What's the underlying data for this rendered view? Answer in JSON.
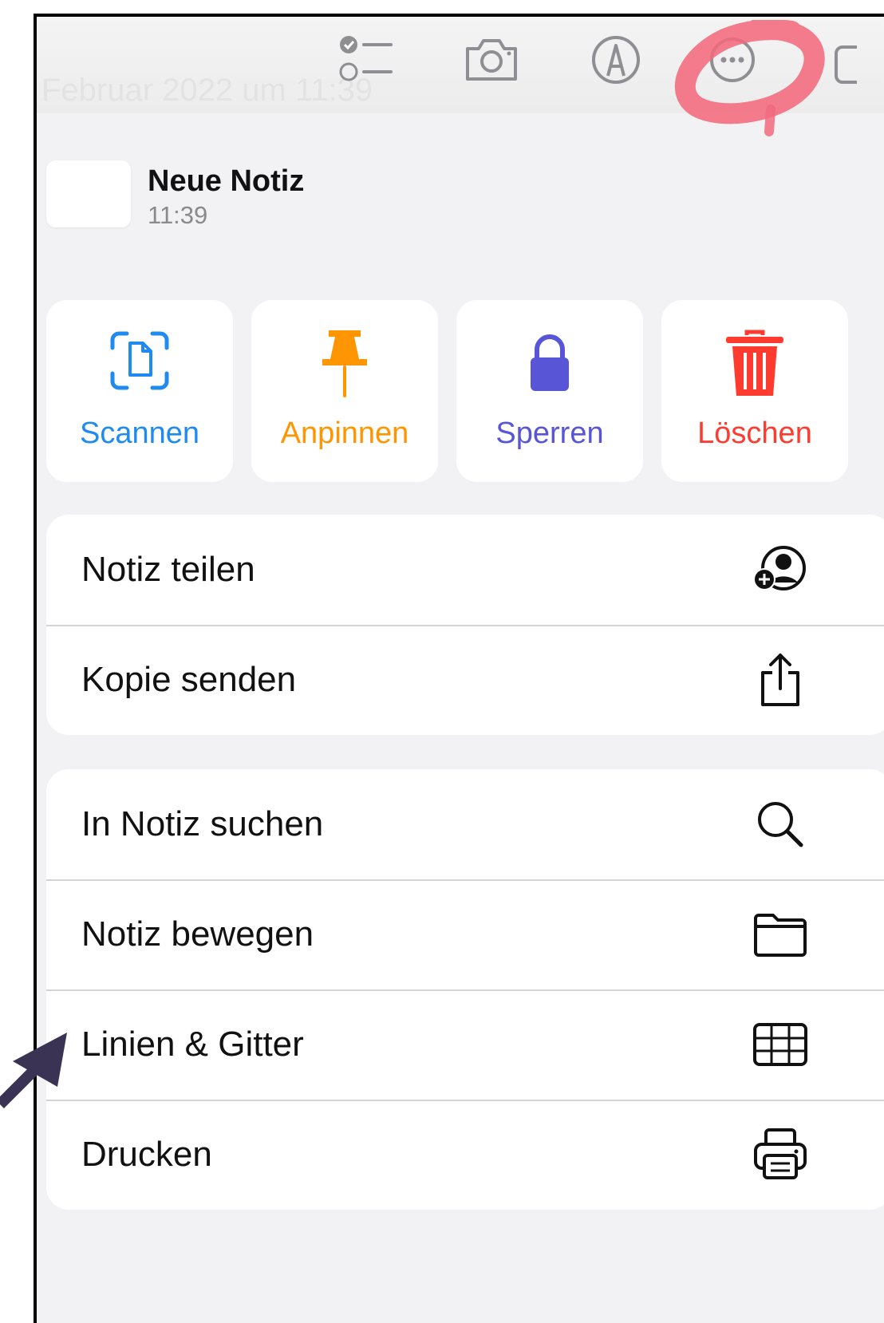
{
  "toolbar": {
    "faded_text": "Februar 2022 um 11:39",
    "icons": [
      "checklist-icon",
      "camera-icon",
      "markup-icon",
      "more-icon"
    ]
  },
  "note": {
    "title": "Neue Notiz",
    "time": "11:39"
  },
  "actions": [
    {
      "label": "Scannen",
      "icon": "scan-icon",
      "color": "#1f8bf0"
    },
    {
      "label": "Anpinnen",
      "icon": "pin-icon",
      "color": "#ff9500"
    },
    {
      "label": "Sperren",
      "icon": "lock-icon",
      "color": "#5856d6"
    },
    {
      "label": "Löschen",
      "icon": "trash-icon",
      "color": "#ff3b30"
    }
  ],
  "menu_group_1": [
    {
      "label": "Notiz teilen",
      "icon": "share-person-icon"
    },
    {
      "label": "Kopie senden",
      "icon": "share-icon"
    }
  ],
  "menu_group_2": [
    {
      "label": "In Notiz suchen",
      "icon": "search-icon"
    },
    {
      "label": "Notiz bewegen",
      "icon": "folder-icon"
    },
    {
      "label": "Linien & Gitter",
      "icon": "grid-icon"
    },
    {
      "label": "Drucken",
      "icon": "printer-icon"
    }
  ],
  "annotations": {
    "highlight_color": "#f26a7c",
    "arrow_color": "#3b3354"
  }
}
